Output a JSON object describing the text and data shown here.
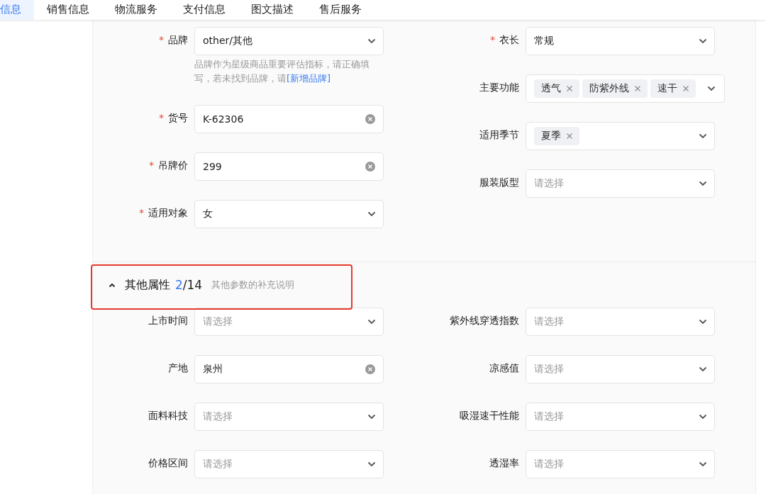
{
  "tabs": [
    {
      "label": "信息",
      "selected": true
    },
    {
      "label": "销售信息",
      "selected": false
    },
    {
      "label": "物流服务",
      "selected": false
    },
    {
      "label": "支付信息",
      "selected": false
    },
    {
      "label": "图文描述",
      "selected": false
    },
    {
      "label": "售后服务",
      "selected": false
    }
  ],
  "basic_section": {
    "left_fields": [
      {
        "required_mark": "*",
        "label": "品牌",
        "kind": "select",
        "value": "other/其他",
        "hint": "品牌作为星级商品重要评估指标，请正确填写，若未找到品牌，请",
        "hint_link": "[新增品牌]"
      },
      {
        "required_mark": "*",
        "label": "货号",
        "kind": "input",
        "value": "K-62306"
      },
      {
        "required_mark": "*",
        "label": "吊牌价",
        "kind": "input",
        "value": "299"
      },
      {
        "required_mark": "*",
        "label": "适用对象",
        "kind": "select",
        "value": "女"
      }
    ],
    "right_fields": [
      {
        "required_mark": "*",
        "label": "衣长",
        "kind": "select",
        "value": "常规"
      },
      {
        "label": "主要功能",
        "kind": "tags",
        "tags": [
          "透气",
          "防紫外线",
          "速干"
        ]
      },
      {
        "label": "适用季节",
        "kind": "tags",
        "tags": [
          "夏季"
        ]
      },
      {
        "label": "服装版型",
        "kind": "select",
        "placeholder": "请选择"
      }
    ]
  },
  "other_section": {
    "title": "其他属性",
    "expanded": true,
    "count_filled": "2",
    "count_rest": "/14",
    "description": "其他参数的补充说明",
    "highlighted": true,
    "left_fields": [
      {
        "label": "上市时间",
        "kind": "select",
        "placeholder": "请选择"
      },
      {
        "label": "产地",
        "kind": "input",
        "value": "泉州"
      },
      {
        "label": "面料科技",
        "kind": "select",
        "placeholder": "请选择"
      },
      {
        "label": "价格区间",
        "kind": "select",
        "placeholder": "请选择"
      }
    ],
    "right_fields": [
      {
        "label": "紫外线穿透指数",
        "kind": "select",
        "placeholder": "请选择"
      },
      {
        "label": "凉感值",
        "kind": "select",
        "placeholder": "请选择"
      },
      {
        "label": "吸湿速干性能",
        "kind": "select",
        "placeholder": "请选择"
      },
      {
        "label": "透湿率",
        "kind": "select",
        "placeholder": "请选择"
      }
    ]
  }
}
